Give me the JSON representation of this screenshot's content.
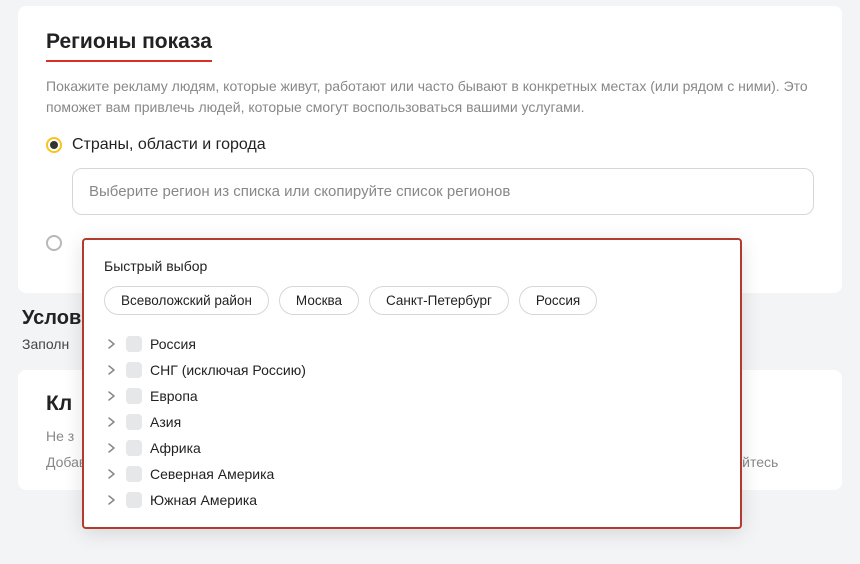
{
  "region_section": {
    "title": "Регионы показа",
    "description": "Покажите рекламу людям, которые живут, работают или часто бывают в конкретных местах (или рядом с ними). Это поможет вам привлечь людей, которые смогут воспользоваться вашими услугами.",
    "radio_label": "Страны, области и города",
    "search_placeholder": "Выберите регион из списка или скопируйте список регионов"
  },
  "popover": {
    "quick_label": "Быстрый выбор",
    "chips": [
      "Всеволожский район",
      "Москва",
      "Санкт-Петербург",
      "Россия"
    ],
    "tree": [
      "Россия",
      "СНГ (исключая Россию)",
      "Европа",
      "Азия",
      "Африка",
      "Северная Америка",
      "Южная Америка"
    ]
  },
  "conditions": {
    "heading": "Услов",
    "sub": "Заполн"
  },
  "keywords": {
    "heading": "Кл",
    "sub": "Не з",
    "text": "Добавьте фразы, по которым будут показаны ваши объявления. Чтобы найти похожие запросы, воспользуйтесь"
  }
}
